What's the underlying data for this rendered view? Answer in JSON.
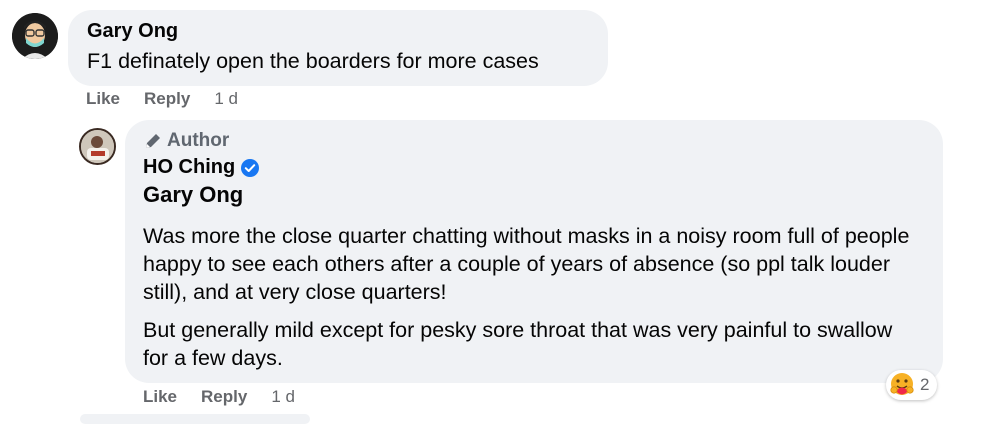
{
  "comment1": {
    "author": "Gary Ong",
    "text": "F1 definately open the boarders for more cases",
    "actions": {
      "like": "Like",
      "reply": "Reply",
      "time": "1 d"
    }
  },
  "comment2": {
    "badge": "Author",
    "author": "HO Ching",
    "verified": true,
    "mention": "Gary Ong",
    "paragraphs": [
      "Was more the close quarter chatting without masks in a noisy room full of people happy to see each others after a couple of years of absence (so ppl talk louder still), and at very close quarters!",
      "But generally mild except for pesky sore throat that was very painful to swallow for a few days."
    ],
    "actions": {
      "like": "Like",
      "reply": "Reply",
      "time": "1 d"
    },
    "reactions": {
      "icon": "care-reaction-icon",
      "count": "2"
    }
  },
  "colors": {
    "bubble": "#f0f2f5",
    "secondary_text": "#65676b",
    "verified_blue": "#1877f2"
  }
}
